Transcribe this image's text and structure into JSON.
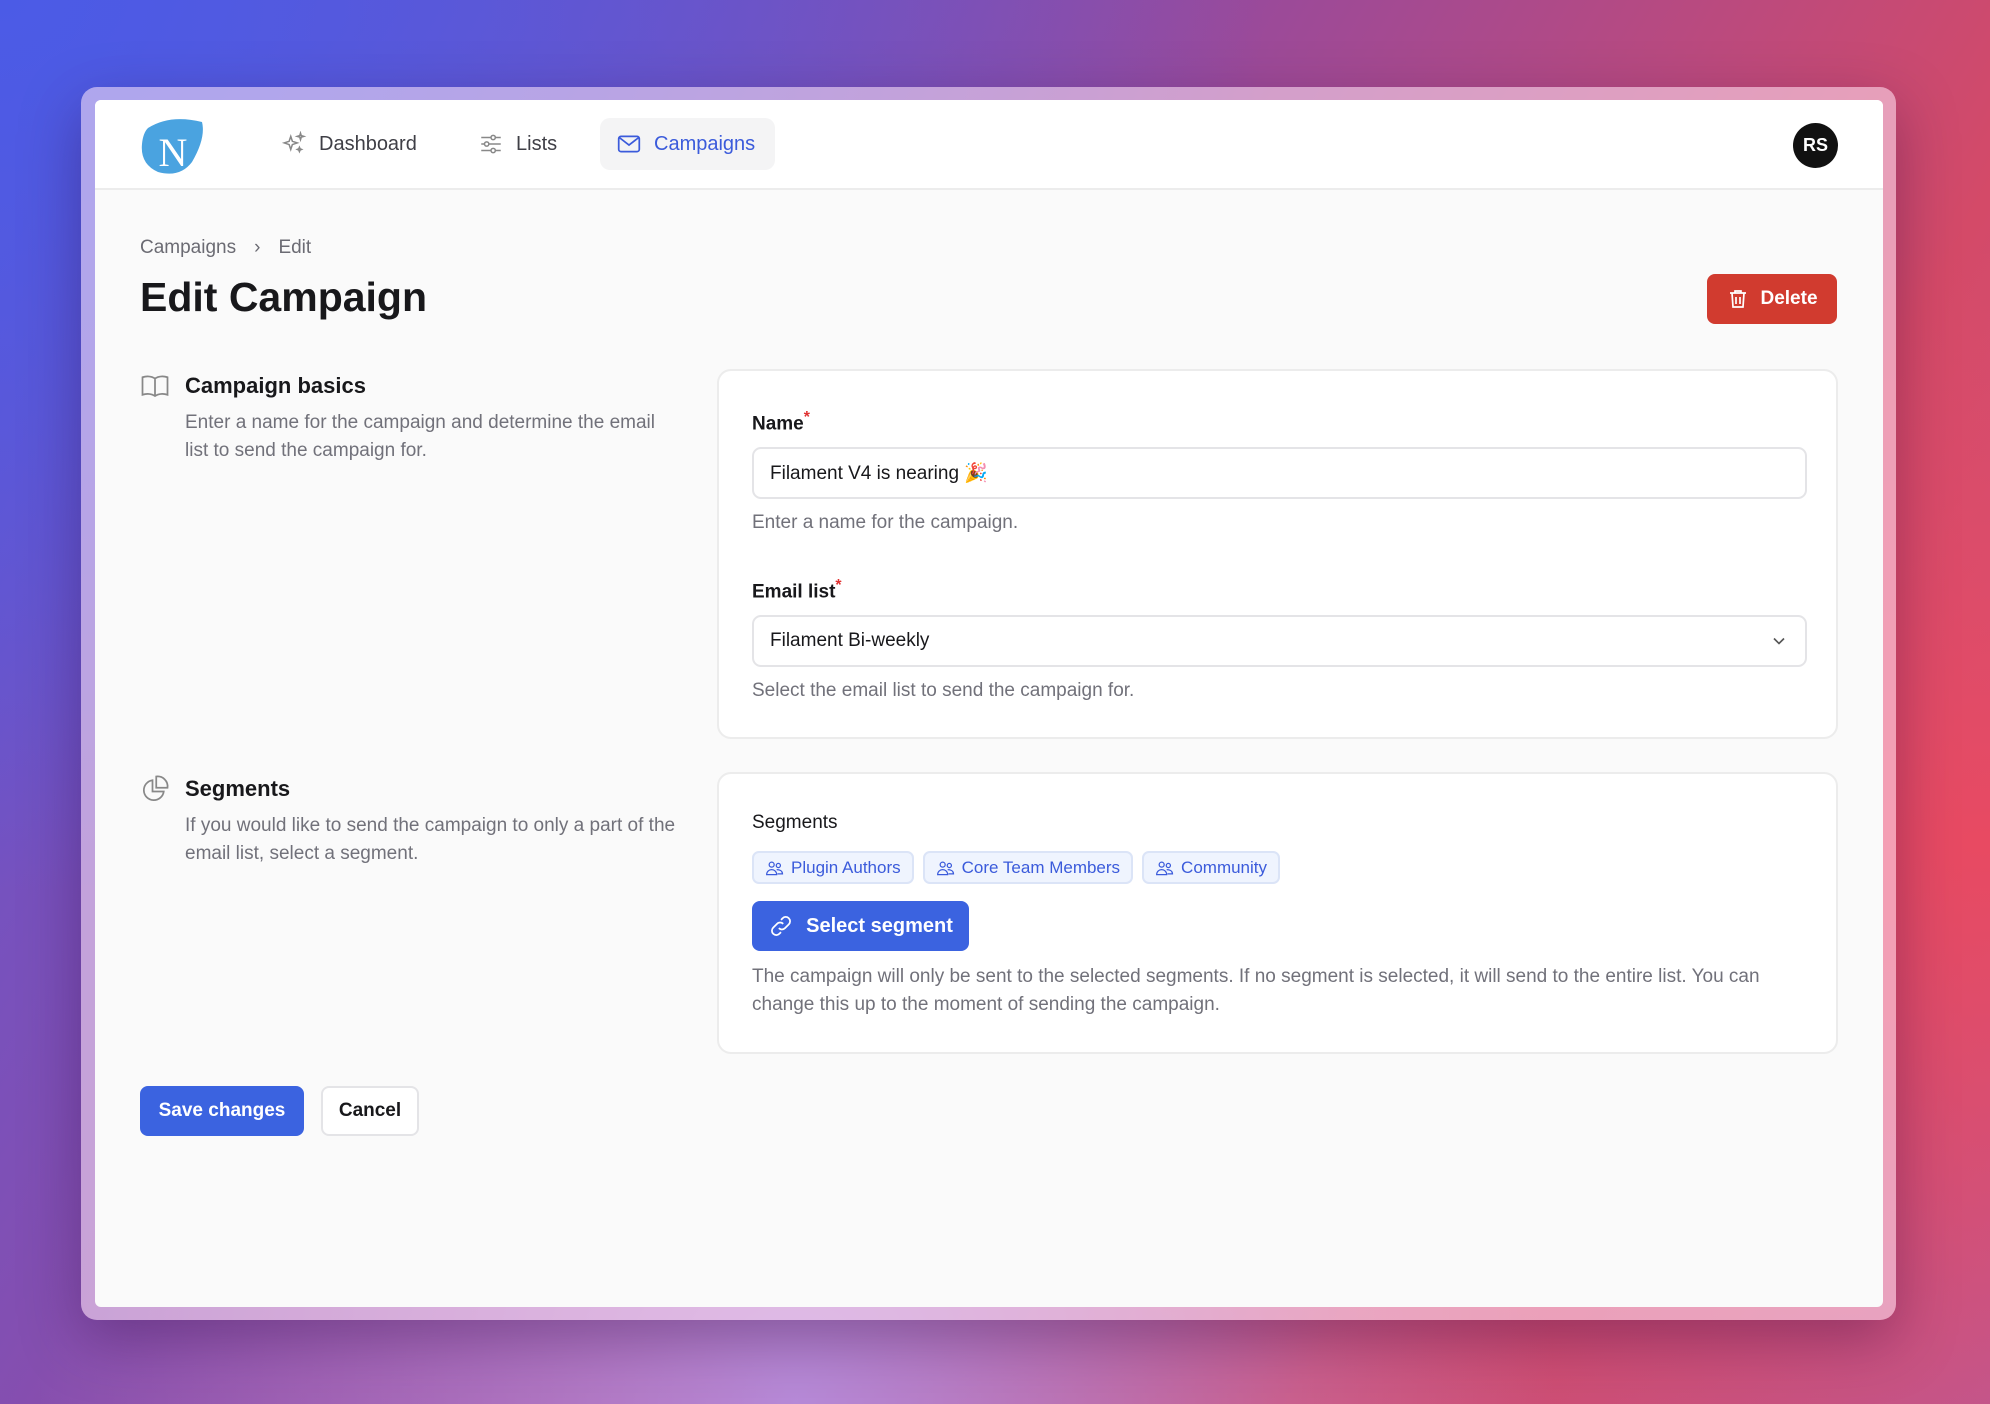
{
  "nav": {
    "logo_letter": "N",
    "items": [
      {
        "label": "Dashboard",
        "icon": "sparkles-icon"
      },
      {
        "label": "Lists",
        "icon": "sliders-icon"
      },
      {
        "label": "Campaigns",
        "icon": "envelope-icon",
        "active": true
      }
    ],
    "avatar": "RS"
  },
  "breadcrumb": [
    "Campaigns",
    "Edit"
  ],
  "title": "Edit Campaign",
  "delete_label": "Delete",
  "basics": {
    "heading": "Campaign basics",
    "description": "Enter a name for the campaign and determine the email list to send the campaign for.",
    "name_label": "Name",
    "name_value": "Filament V4 is nearing 🎉",
    "name_help": "Enter a name for the campaign.",
    "list_label": "Email list",
    "list_value": "Filament Bi-weekly",
    "list_help": "Select the email list to send the campaign for."
  },
  "segments": {
    "heading": "Segments",
    "description": "If you would like to send the campaign to only a part of the email list, select a segment.",
    "label": "Segments",
    "badges": [
      "Plugin Authors",
      "Core Team Members",
      "Community"
    ],
    "select_label": "Select segment",
    "help": "The campaign will only be sent to the selected segments. If no segment is selected, it will send to the entire list. You can change this up to the moment of sending the campaign."
  },
  "actions": {
    "save": "Save changes",
    "cancel": "Cancel"
  },
  "colors": {
    "primary": "#3b63e0",
    "danger": "#d13b2f",
    "logo": "#4aa3e0"
  }
}
